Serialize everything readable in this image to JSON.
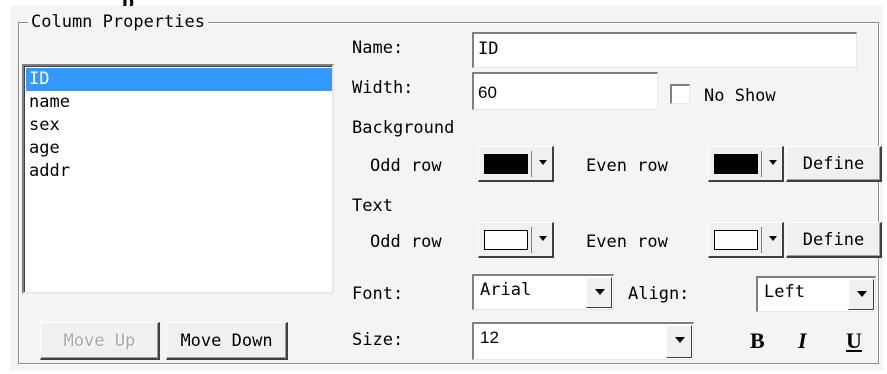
{
  "header_partial": "p",
  "group_title": "Column Properties",
  "columns": [
    {
      "label": "ID",
      "selected": true
    },
    {
      "label": "name",
      "selected": false
    },
    {
      "label": "sex",
      "selected": false
    },
    {
      "label": "age",
      "selected": false
    },
    {
      "label": "addr",
      "selected": false
    }
  ],
  "buttons": {
    "move_up": "Move Up",
    "move_down": "Move Down",
    "define_bg": "Define",
    "define_text": "Define"
  },
  "labels": {
    "name": "Name:",
    "width": "Width:",
    "no_show": "No Show",
    "background": "Background",
    "odd_row_bg": "Odd row",
    "even_row_bg": "Even row",
    "text": "Text",
    "odd_row_text": "Odd row",
    "even_row_text": "Even row",
    "font": "Font:",
    "align": "Align:",
    "size": "Size:"
  },
  "values": {
    "name": "ID",
    "width": "60",
    "no_show_checked": false,
    "font": "Arial",
    "align": "Left",
    "size": "12"
  },
  "colors": {
    "bg_odd_row": "#000000",
    "bg_even_row": "#000000",
    "text_odd_row": "#ffffff",
    "text_even_row": "#ffffff",
    "selection": "#3399ff"
  },
  "format": {
    "bold": "B",
    "italic": "I",
    "underline": "U"
  }
}
